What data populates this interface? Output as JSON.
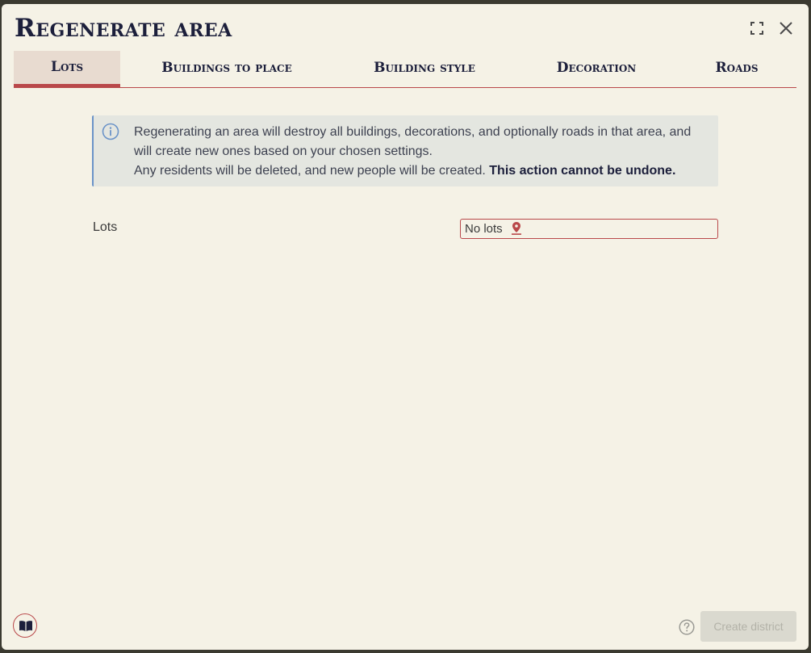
{
  "window": {
    "title": "Regenerate area"
  },
  "tabs": [
    {
      "label": "Lots",
      "active": true
    },
    {
      "label": "Buildings to place",
      "active": false
    },
    {
      "label": "Building style",
      "active": false
    },
    {
      "label": "Decoration",
      "active": false
    },
    {
      "label": "Roads",
      "active": false
    }
  ],
  "info": {
    "line1": "Regenerating an area will destroy all buildings, decorations, and optionally roads in that area, and will create new ones based on your chosen settings.",
    "line2": "Any residents will be deleted, and new people will be created.",
    "warning": "This action cannot be undone."
  },
  "lots_field": {
    "label": "Lots",
    "value": "No lots",
    "icon": "map-pin-icon"
  },
  "footer": {
    "create_button": "Create district",
    "create_enabled": false
  },
  "colors": {
    "accent": "#b9484a",
    "title": "#1c1f3b",
    "background": "#f5f2e6",
    "info_border": "#6a93c8"
  }
}
